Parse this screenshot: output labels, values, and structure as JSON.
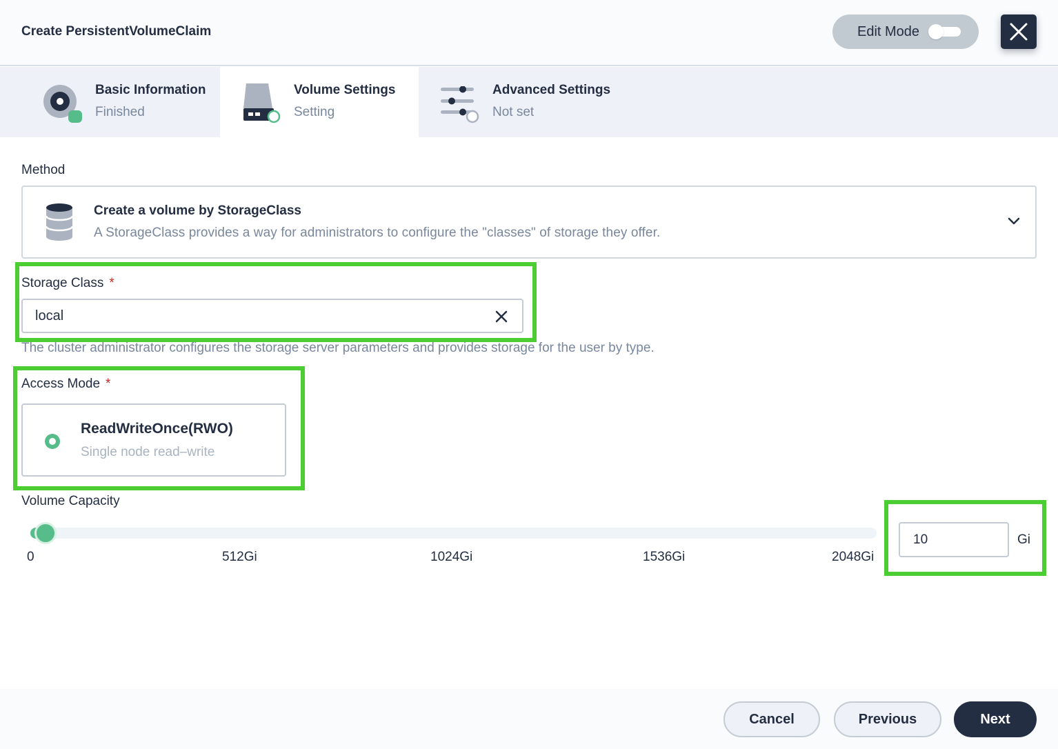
{
  "header": {
    "title": "Create PersistentVolumeClaim",
    "edit_mode_label": "Edit Mode"
  },
  "tabs": [
    {
      "title": "Basic Information",
      "status": "Finished",
      "icon": "disk-icon"
    },
    {
      "title": "Volume Settings",
      "status": "Setting",
      "icon": "hard-drive-icon"
    },
    {
      "title": "Advanced Settings",
      "status": "Not set",
      "icon": "sliders-icon"
    }
  ],
  "method": {
    "label": "Method",
    "title": "Create a volume by StorageClass",
    "description": "A StorageClass provides a way for administrators to configure the \"classes\" of storage they offer."
  },
  "storage_class": {
    "label": "Storage Class",
    "required_mark": "*",
    "value": "local",
    "hint": "The cluster administrator configures the storage server parameters and provides storage for the user by type."
  },
  "access_mode": {
    "label": "Access Mode",
    "required_mark": "*",
    "option_title": "ReadWriteOnce(RWO)",
    "option_desc": "Single node read–write"
  },
  "capacity": {
    "label": "Volume Capacity",
    "value": "10",
    "unit": "Gi",
    "slider_value": 10,
    "slider_max": 2048,
    "ticks": [
      "0",
      "512Gi",
      "1024Gi",
      "1536Gi",
      "2048Gi"
    ]
  },
  "footer": {
    "cancel": "Cancel",
    "previous": "Previous",
    "next": "Next"
  },
  "colors": {
    "primary": "#242e42",
    "accent_green": "#55bc8a",
    "highlight": "#4ccd32",
    "required": "#ca2621"
  }
}
